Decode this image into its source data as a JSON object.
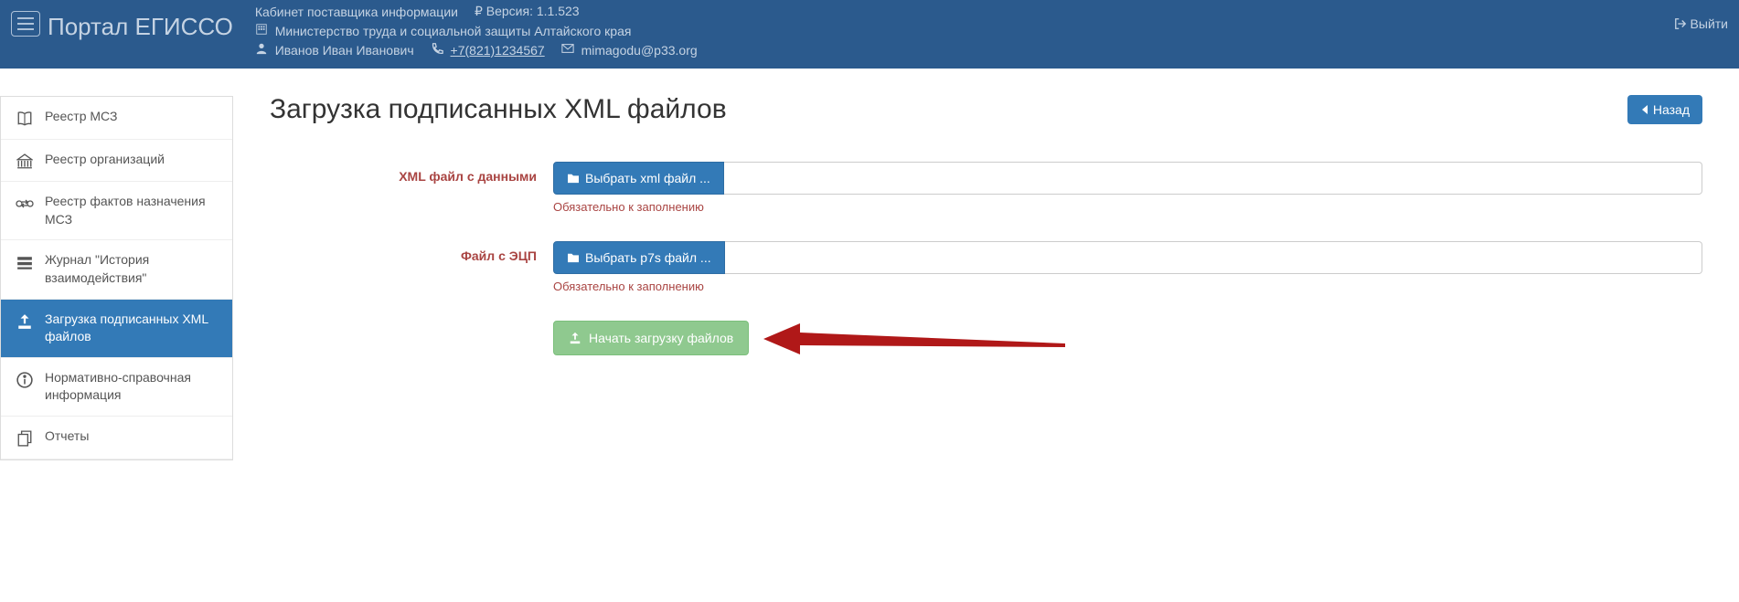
{
  "header": {
    "logo": "Портал ЕГИССО",
    "cabinet": "Кабинет поставщика информации",
    "version": "₽ Версия: 1.1.523",
    "ministry": "Министерство труда и социальной защиты Алтайского края",
    "user": "Иванов Иван Иванович",
    "phone": "+7(821)1234567",
    "email": "mimagodu@p33.org",
    "logout": "Выйти"
  },
  "sidebar": {
    "items": [
      {
        "label": "Реестр МСЗ"
      },
      {
        "label": "Реестр организаций"
      },
      {
        "label": "Реестр фактов назначения МСЗ"
      },
      {
        "label": "Журнал \"История взаимодействия\""
      },
      {
        "label": "Загрузка подписанных XML файлов"
      },
      {
        "label": "Нормативно-справочная информация"
      },
      {
        "label": "Отчеты"
      }
    ]
  },
  "page": {
    "title": "Загрузка подписанных XML файлов",
    "back": "Назад"
  },
  "form": {
    "xml_label": "XML файл с данными",
    "xml_button": "Выбрать xml файл ...",
    "xml_help": "Обязательно к заполнению",
    "sig_label": "Файл с ЭЦП",
    "sig_button": "Выбрать p7s файл ...",
    "sig_help": "Обязательно к заполнению",
    "upload": "Начать загрузку файлов"
  }
}
